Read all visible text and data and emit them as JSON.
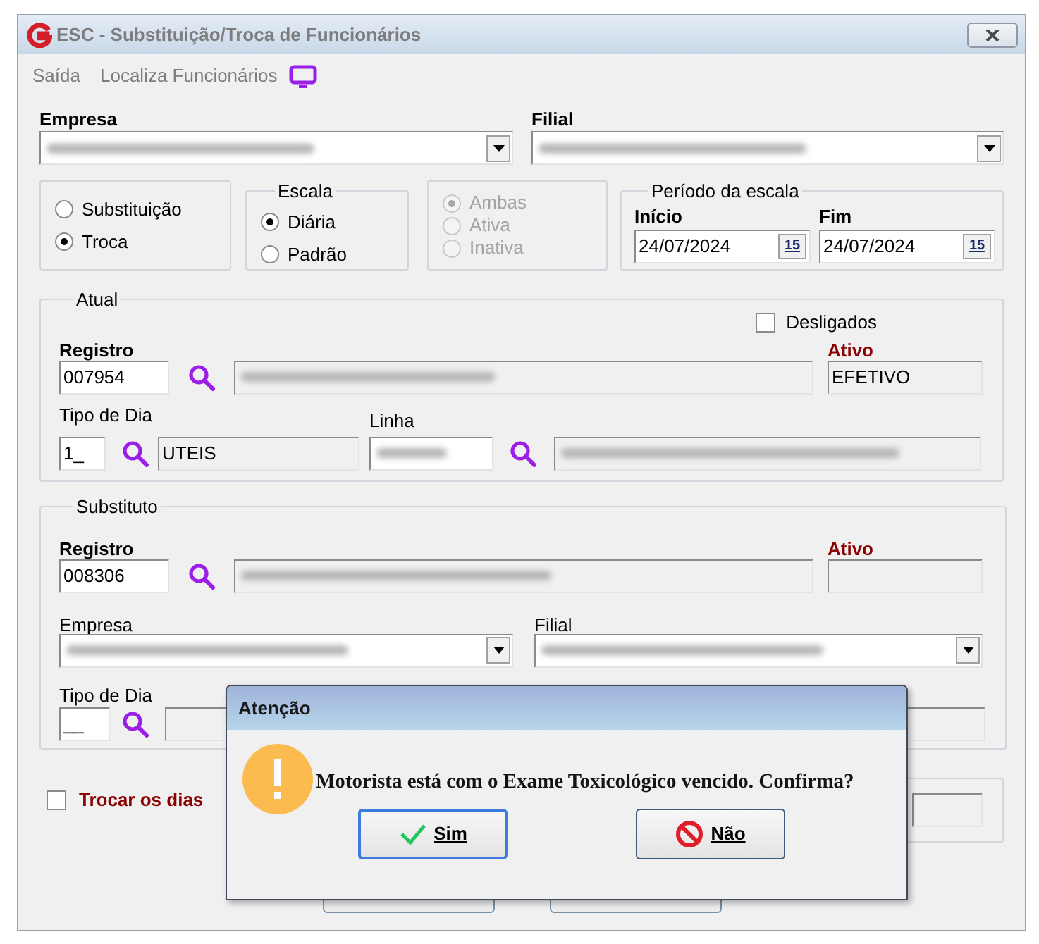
{
  "window": {
    "title": "ESC - Substituição/Troca de Funcionários"
  },
  "menu": [
    {
      "label": "Saída"
    },
    {
      "label": "Localiza Funcionários"
    }
  ],
  "empresa": {
    "label": "Empresa"
  },
  "filial": {
    "label": "Filial"
  },
  "mode_options": [
    {
      "label": "Substituição",
      "selected": false
    },
    {
      "label": "Troca",
      "selected": true
    }
  ],
  "escala": {
    "title": "Escala",
    "options": [
      {
        "label": "Diária",
        "selected": true
      },
      {
        "label": "Padrão",
        "selected": false
      }
    ]
  },
  "status_options": {
    "disabled": true,
    "options": [
      {
        "label": "Ambas",
        "selected": true
      },
      {
        "label": "Ativa",
        "selected": false
      },
      {
        "label": "Inativa",
        "selected": false
      }
    ]
  },
  "periodo": {
    "title": "Período da escala",
    "fields": [
      {
        "label": "Início",
        "value": "24/07/2024",
        "calendar_text": "15"
      },
      {
        "label": "Fim",
        "value": "24/07/2024",
        "calendar_text": "15"
      }
    ]
  },
  "atual": {
    "title": "Atual",
    "desligados": {
      "label": "Desligados",
      "checked": false
    },
    "registro": {
      "label": "Registro",
      "value": "007954"
    },
    "ativo": {
      "label": "Ativo",
      "value": "EFETIVO"
    },
    "tipo_dia": {
      "label": "Tipo de Dia",
      "code": "1_",
      "description": "UTEIS"
    },
    "linha": {
      "label": "Linha"
    }
  },
  "substituto": {
    "title": "Substituto",
    "registro": {
      "label": "Registro",
      "value": "008306"
    },
    "ativo": {
      "label": "Ativo"
    },
    "empresa": {
      "label": "Empresa"
    },
    "filial": {
      "label": "Filial"
    },
    "tipo_dia": {
      "label": "Tipo de Dia",
      "code": "__"
    }
  },
  "trocar_dias": {
    "label": "Trocar os dias",
    "checked": false
  },
  "dialog": {
    "title": "Atenção",
    "message": "Motorista está com o Exame Toxicológico vencido. Confirma?",
    "buttons": [
      {
        "label": "Sim",
        "kind": "confirm",
        "focused": true
      },
      {
        "label": "Não",
        "kind": "cancel",
        "focused": false
      }
    ]
  }
}
